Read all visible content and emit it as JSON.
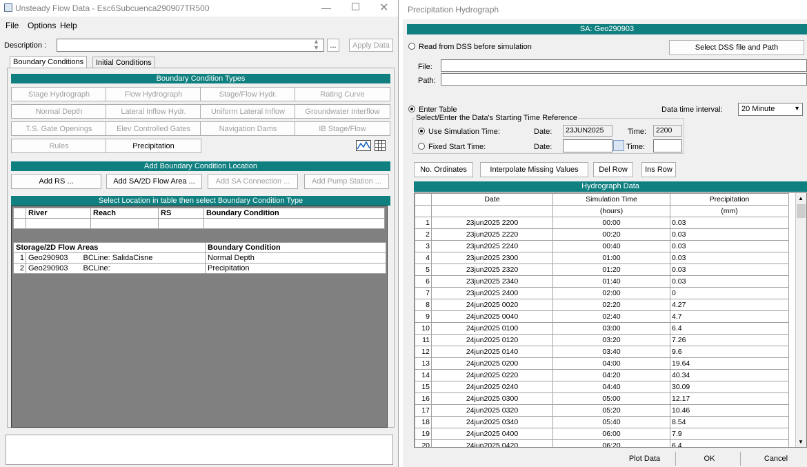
{
  "left_window": {
    "title": "Unsteady Flow Data - Esc6Subcuenca290907TR500",
    "menu": [
      "File",
      "Options",
      "Help"
    ],
    "description_label": "Description :",
    "description_value": "",
    "browse_label": "...",
    "apply_label": "Apply Data",
    "tabs": [
      "Boundary Conditions",
      "Initial Conditions"
    ],
    "bc_types_header": "Boundary Condition Types",
    "bc_types": [
      [
        "Stage Hydrograph",
        "Flow Hydrograph",
        "Stage/Flow Hydr.",
        "Rating Curve"
      ],
      [
        "Normal Depth",
        "Lateral Inflow Hydr.",
        "Uniform Lateral Inflow",
        "Groundwater Interflow"
      ],
      [
        "T.S. Gate Openings",
        "Elev Controlled Gates",
        "Navigation Dams",
        "IB Stage/Flow"
      ],
      [
        "Rules",
        "Precipitation"
      ]
    ],
    "add_location_header": "Add Boundary Condition Location",
    "add_buttons": [
      "Add RS ...",
      "Add SA/2D Flow Area ...",
      "Add SA Connection ...",
      "Add Pump Station ..."
    ],
    "select_header": "Select Location in table then select Boundary Condition Type",
    "river_headers": [
      "River",
      "Reach",
      "RS",
      "Boundary Condition"
    ],
    "storage_headers": [
      "Storage/2D Flow Areas",
      "Boundary Condition"
    ],
    "storage_rows": [
      {
        "n": "1",
        "area": "Geo290903",
        "bcline": "BCLine: SalidaCisne",
        "bc": "Normal Depth"
      },
      {
        "n": "2",
        "area": "Geo290903",
        "bcline": "BCLine:",
        "bc": "Precipitation"
      }
    ]
  },
  "right_window": {
    "title": "Precipitation Hydrograph",
    "sa_header": "SA: Geo290903",
    "read_dss_label": "Read from DSS before simulation",
    "select_dss_label": "Select DSS file and Path",
    "file_label": "File:",
    "path_label": "Path:",
    "enter_table_label": "Enter Table",
    "interval_label": "Data time interval:",
    "interval_value": "20 Minute",
    "time_ref_legend": "Select/Enter the Data's Starting Time Reference",
    "use_sim_label": "Use Simulation Time:",
    "fixed_start_label": "Fixed Start Time:",
    "date_label": "Date:",
    "time_label": "Time:",
    "sim_date": "23JUN2025",
    "sim_time": "2200",
    "toolbar": [
      "No. Ordinates",
      "Interpolate Missing Values",
      "Del Row",
      "Ins Row"
    ],
    "grid_header": "Hydrograph Data",
    "col_headers": [
      "Date",
      "Simulation Time",
      "Precipitation"
    ],
    "col_units": [
      "",
      "(hours)",
      "(mm)"
    ],
    "rows": [
      [
        "1",
        "23jun2025 2200",
        "00:00",
        "0.03"
      ],
      [
        "2",
        "23jun2025 2220",
        "00:20",
        "0.03"
      ],
      [
        "3",
        "23jun2025 2240",
        "00:40",
        "0.03"
      ],
      [
        "4",
        "23jun2025 2300",
        "01:00",
        "0.03"
      ],
      [
        "5",
        "23jun2025 2320",
        "01:20",
        "0.03"
      ],
      [
        "6",
        "23jun2025 2340",
        "01:40",
        "0.03"
      ],
      [
        "7",
        "23jun2025 2400",
        "02:00",
        "0"
      ],
      [
        "8",
        "24jun2025 0020",
        "02:20",
        "4.27"
      ],
      [
        "9",
        "24jun2025 0040",
        "02:40",
        "4.7"
      ],
      [
        "10",
        "24jun2025 0100",
        "03:00",
        "6.4"
      ],
      [
        "11",
        "24jun2025 0120",
        "03:20",
        "7.26"
      ],
      [
        "12",
        "24jun2025 0140",
        "03:40",
        "9.6"
      ],
      [
        "13",
        "24jun2025 0200",
        "04:00",
        "19.64"
      ],
      [
        "14",
        "24jun2025 0220",
        "04:20",
        "40.34"
      ],
      [
        "15",
        "24jun2025 0240",
        "04:40",
        "30.09"
      ],
      [
        "16",
        "24jun2025 0300",
        "05:00",
        "12.17"
      ],
      [
        "17",
        "24jun2025 0320",
        "05:20",
        "10.46"
      ],
      [
        "18",
        "24jun2025 0340",
        "05:40",
        "8.54"
      ],
      [
        "19",
        "24jun2025 0400",
        "06:00",
        "7.9"
      ],
      [
        "20",
        "24jun2025 0420",
        "06:20",
        "6.4"
      ]
    ],
    "bottom_buttons": [
      "Plot Data",
      "OK",
      "Cancel"
    ]
  },
  "colors": {
    "header_teal": "#0f7f7f",
    "grid_gray": "#808080"
  }
}
